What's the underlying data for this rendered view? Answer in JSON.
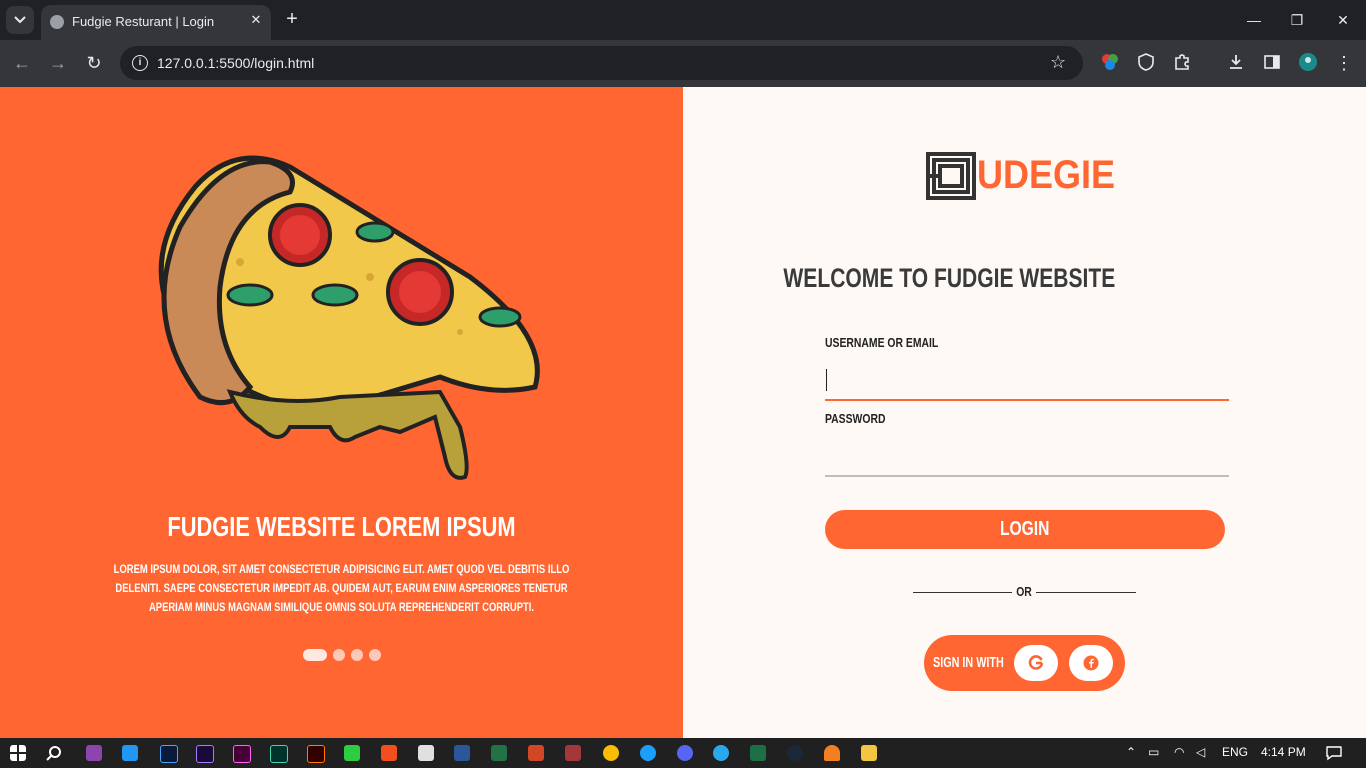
{
  "browser": {
    "tab_title": "Fudgie Resturant | Login",
    "url": "127.0.0.1:5500/login.html"
  },
  "hero": {
    "title": "FUDGIE WEBSITE LOREM IPSUM",
    "body": "LOREM IPSUM DOLOR, SIT AMET CONSECTETUR ADIPISICING ELIT. AMET QUOD VEL DEBITIS ILLO DELENITI. SAEPE CONSECTETUR IMPEDIT AB. QUIDEM AUT, EARUM ENIM ASPERIORES TENETUR APERIAM MINUS MAGNAM SIMILIQUE OMNIS SOLUTA REPREHENDERIT CORRUPTI.",
    "slides_total": 4,
    "active_slide": 1
  },
  "brand": {
    "logo_text": "UDEGIE",
    "accent": "#ff6631",
    "panel_bg": "#fff9f5"
  },
  "login": {
    "welcome": "WELCOME TO FUDGIE WEBSITE",
    "username_label": "USERNAME OR EMAIL",
    "username_value": "",
    "password_label": "PASSWORD",
    "password_value": "",
    "login_button": "LOGIN",
    "or_text": "OR",
    "sign_in_with": "SIGN IN WITH",
    "providers": [
      "google-icon",
      "facebook-icon"
    ]
  },
  "taskbar": {
    "language": "ENG",
    "time": "4:14 PM"
  }
}
